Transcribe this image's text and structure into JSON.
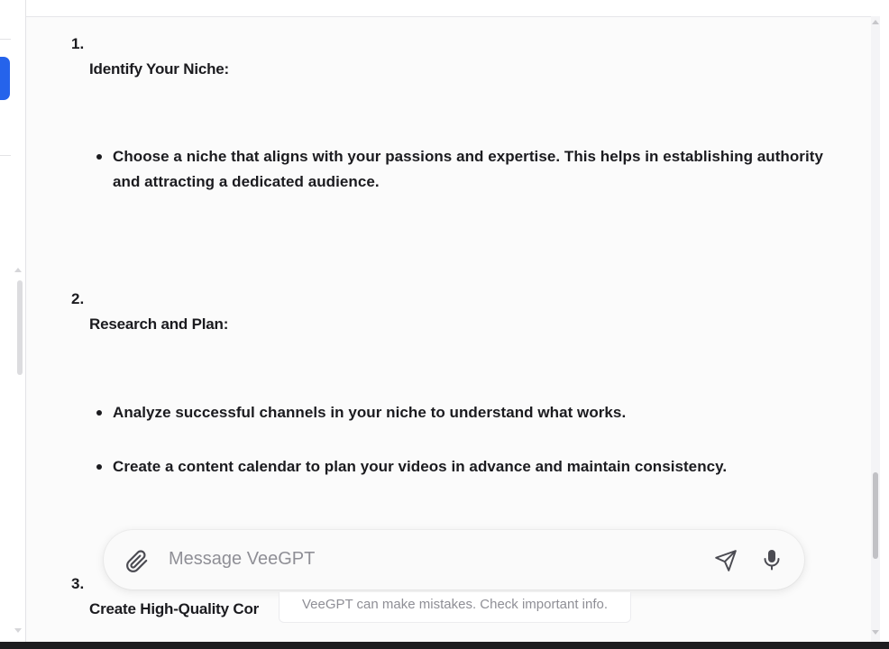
{
  "steps": [
    {
      "number": "1.",
      "title": "Identify Your Niche",
      "bullets": [
        "Choose a niche that aligns with your passions and expertise. This helps in establishing authority and attracting a dedicated audience."
      ]
    },
    {
      "number": "2.",
      "title": "Research and Plan",
      "bullets": [
        "Analyze successful channels in your niche to understand what works.",
        "Create a content calendar to plan your videos in advance and maintain consistency."
      ]
    },
    {
      "number": "3.",
      "title": "Create High-Quality Cor",
      "bullets": []
    }
  ],
  "composer": {
    "placeholder": "Message VeeGPT",
    "disclaimer": "VeeGPT can make mistakes. Check important info."
  },
  "colors": {
    "accent": "#2563eb",
    "text": "#1b1b1f",
    "muted": "#8f8f96"
  },
  "icons": {
    "attach": "paperclip-icon",
    "send": "send-icon",
    "mic": "microphone-icon"
  }
}
